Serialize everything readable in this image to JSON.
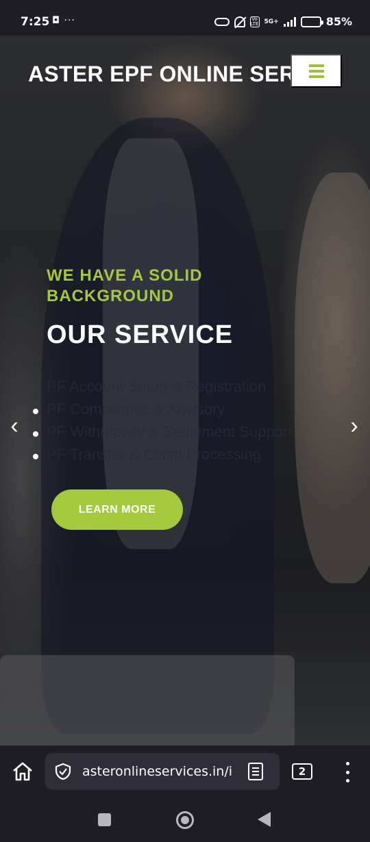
{
  "status_bar": {
    "time": "7:25",
    "left_icons": "◘ ···",
    "network": "5G+",
    "volte": "Vo LTE",
    "battery_percent": "85%",
    "battery_level": 0.85
  },
  "header": {
    "brand": "ASTER EPF ONLINE SERVICES",
    "menu_icon": "hamburger-icon"
  },
  "hero": {
    "tagline": "WE HAVE A SOLID BACKGROUND",
    "title": "OUR SERVICE",
    "services": [
      "PF Account Setup & Registration",
      "PF Compliance & Advisory",
      "PF Withdrawal & Settlement Support",
      "PF Transfer & Claim Processing"
    ],
    "cta_label": "LEARN MORE",
    "accent_color": "#a5c93c",
    "prev_icon": "‹",
    "next_icon": "›"
  },
  "browser": {
    "url": "asteronlineservices.in/index",
    "tab_count": "2",
    "icons": [
      "home-icon",
      "shield-icon",
      "reader-mode-icon",
      "tabs-icon",
      "more-icon"
    ]
  },
  "nav": {
    "icons": [
      "recents-icon",
      "home-circle-icon",
      "back-icon"
    ]
  }
}
